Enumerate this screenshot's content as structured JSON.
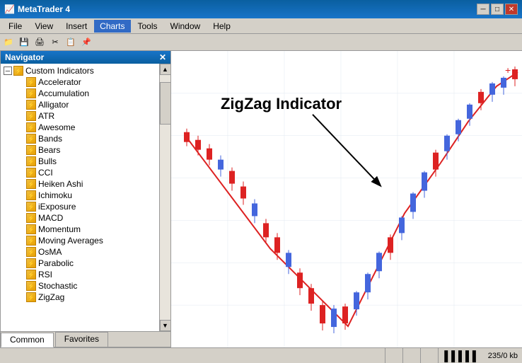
{
  "window": {
    "title": "MetaTrader 4",
    "icon": "📈"
  },
  "titlebar": {
    "controls": {
      "minimize": "─",
      "maximize": "□",
      "close": "✕"
    }
  },
  "menubar": {
    "items": [
      "File",
      "View",
      "Insert",
      "Charts",
      "Tools",
      "Window",
      "Help"
    ]
  },
  "navigator": {
    "title": "Navigator",
    "close": "✕",
    "root": {
      "expand": "─",
      "icon": "📁",
      "label": "Custom Indicators"
    },
    "items": [
      "Accelerator",
      "Accumulation",
      "Alligator",
      "ATR",
      "Awesome",
      "Bands",
      "Bears",
      "Bulls",
      "CCI",
      "Heiken Ashi",
      "Ichimoku",
      "iExposure",
      "MACD",
      "Momentum",
      "Moving Averages",
      "OsMA",
      "Parabolic",
      "RSI",
      "Stochastic",
      "ZigZag"
    ],
    "tabs": [
      "Common",
      "Favorites"
    ]
  },
  "chart": {
    "label": "ZigZag Indicator",
    "background": "#1a1a2e"
  },
  "statusbar": {
    "bars_icon": "▌▌▌▌▌",
    "memory": "235/0 kb"
  },
  "colors": {
    "bull_candle": "#4488ff",
    "bear_candle": "#ff4444",
    "zigzag_line": "#ff4444",
    "chart_bg": "#ffffff",
    "grid": "#e0e8f0"
  }
}
